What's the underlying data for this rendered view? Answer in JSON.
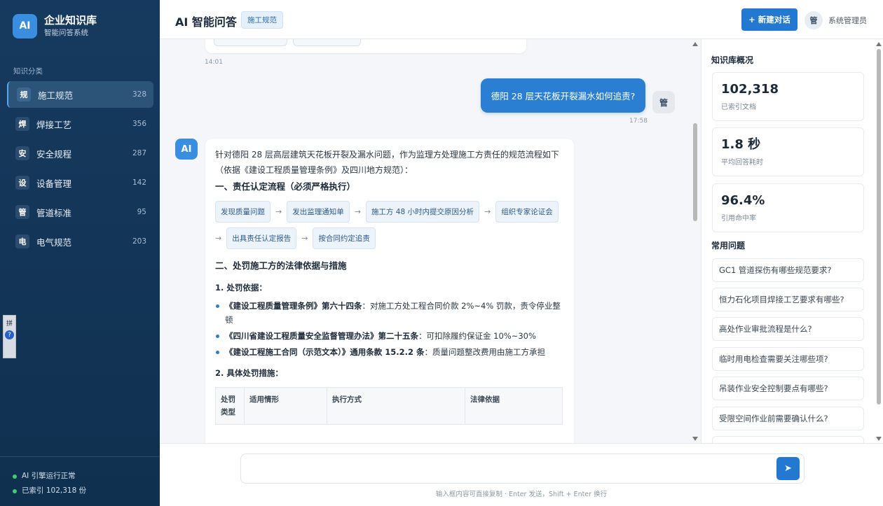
{
  "brand": {
    "logo": "AI",
    "title": "企业知识库",
    "subtitle": "智能问答系统"
  },
  "sidebar": {
    "section_label": "知识分类",
    "items": [
      {
        "badge": "规",
        "label": "施工规范",
        "count": "328",
        "active": true
      },
      {
        "badge": "焊",
        "label": "焊接工艺",
        "count": "356"
      },
      {
        "badge": "安",
        "label": "安全规程",
        "count": "287"
      },
      {
        "badge": "设",
        "label": "设备管理",
        "count": "142"
      },
      {
        "badge": "管",
        "label": "管道标准",
        "count": "95"
      },
      {
        "badge": "电",
        "label": "电气规范",
        "count": "203"
      }
    ],
    "status": [
      "AI 引擎运行正常",
      "已索引 102,318 份"
    ],
    "ime": {
      "label": "拼",
      "help": "?"
    }
  },
  "header": {
    "title": "AI 智能问答",
    "tag": "施工规范",
    "new_chat_label": "+ 新建对话",
    "user_avatar": "管",
    "user_name": "系统管理员"
  },
  "chat": {
    "prev_time": "14:01",
    "user_message": "德阳 28 层天花板开裂漏水如何追责?",
    "user_avatar": "管",
    "user_time": "17:58",
    "ai_avatar": "AI",
    "ai": {
      "intro": "针对德阳 28 层高层建筑天花板开裂及漏水问题，作为监理方处理施工方责任的规范流程如下（依据《建设工程质量管理条例》及四川地方规范）：",
      "section1": "一、责任认定流程（必须严格执行）",
      "flow": [
        "发现质量问题",
        "发出监理通知单",
        "施工方 48 小时内提交原因分析",
        "组织专家论证会",
        "出具责任认定报告",
        "按合同约定追责"
      ],
      "arrow": "→",
      "section2": "二、处罚施工方的法律依据与措施",
      "sub1": "1. 处罚依据：",
      "bullets": [
        {
          "bold": "《建设工程质量管理条例》第六十四条",
          "text": "：对施工方处工程合同价款 2%~4% 罚款，责令停业整顿"
        },
        {
          "bold": "《四川省建设工程质量安全监督管理办法》第二十五条",
          "text": "：可扣除履约保证金 10%~30%"
        },
        {
          "bold": "《建设工程施工合同（示范文本）》通用条款 15.2.2 条",
          "text": "：质量问题整改费用由施工方承担"
        }
      ],
      "sub2": "2. 具体处罚措施：",
      "table_headers": [
        "处罚类型",
        "适用情形",
        "执行方式",
        "法律依据"
      ]
    }
  },
  "right_panel": {
    "overview_title": "知识库概况",
    "stats": [
      {
        "value": "102,318",
        "label": "已索引文档"
      },
      {
        "value": "1.8 秒",
        "label": "平均回答耗时"
      },
      {
        "value": "96.4%",
        "label": "引用命中率"
      }
    ],
    "faq_title": "常用问题",
    "faqs": [
      "GC1 管道探伤有哪些规范要求?",
      "恒力石化项目焊接工艺要求有哪些?",
      "高处作业审批流程是什么?",
      "临时用电检查需要关注哪些项?",
      "吊装作业安全控制要点有哪些?",
      "受限空间作业前需要确认什么?"
    ]
  },
  "composer": {
    "placeholder": "",
    "send_icon": "➤",
    "hint": "输入框内容可直接复制 · Enter 发送，Shift + Enter 换行"
  }
}
